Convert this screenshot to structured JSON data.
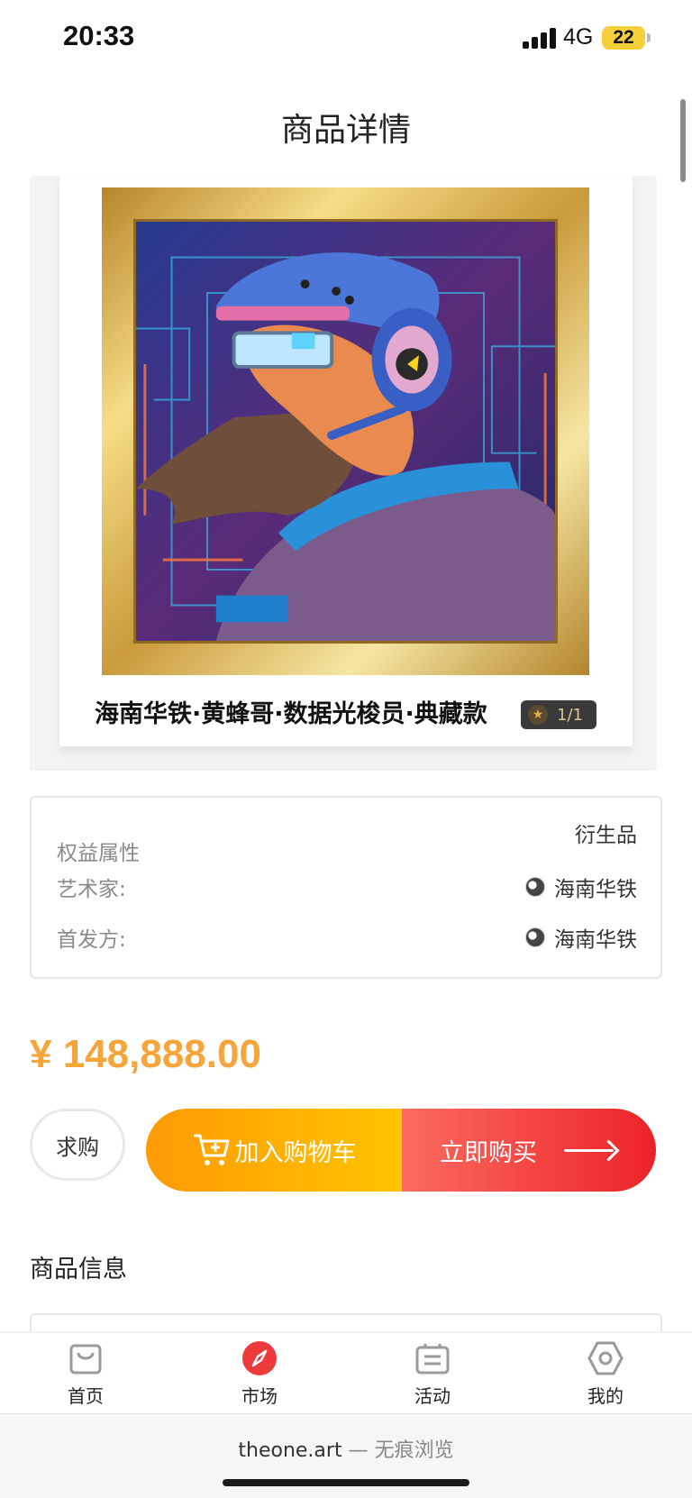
{
  "status_bar": {
    "time": "20:33",
    "network": "4G",
    "battery": "22"
  },
  "header": {
    "title": "商品详情"
  },
  "product": {
    "name": "海南华铁·黄蜂哥·数据光梭员·典藏款",
    "edition": "1/1"
  },
  "attributes": {
    "rights_label": "权益属性",
    "rights_value": "衍生品",
    "artist_label": "艺术家:",
    "artist_value": "海南华铁",
    "publisher_label": "首发方:",
    "publisher_value": "海南华铁"
  },
  "price": "¥ 148,888.00",
  "actions": {
    "want_label": "求购",
    "cart_label": "加入购物车",
    "buy_label": "立即购买"
  },
  "section": {
    "title": "商品信息"
  },
  "tabs": [
    {
      "label": "首页",
      "icon": "shopping-bag-icon",
      "active": false
    },
    {
      "label": "市场",
      "icon": "compass-icon",
      "active": true,
      "color": "#ee3a3a"
    },
    {
      "label": "活动",
      "icon": "ticket-icon",
      "active": false
    },
    {
      "label": "我的",
      "icon": "hexagon-profile-icon",
      "active": false
    }
  ],
  "browser": {
    "domain": "theone.art",
    "mode": "无痕浏览"
  },
  "colors": {
    "price": "#f5a53a",
    "cart_start": "#ff9a04",
    "buy_end": "#ec2329",
    "accent_tab": "#ee3a3a"
  }
}
